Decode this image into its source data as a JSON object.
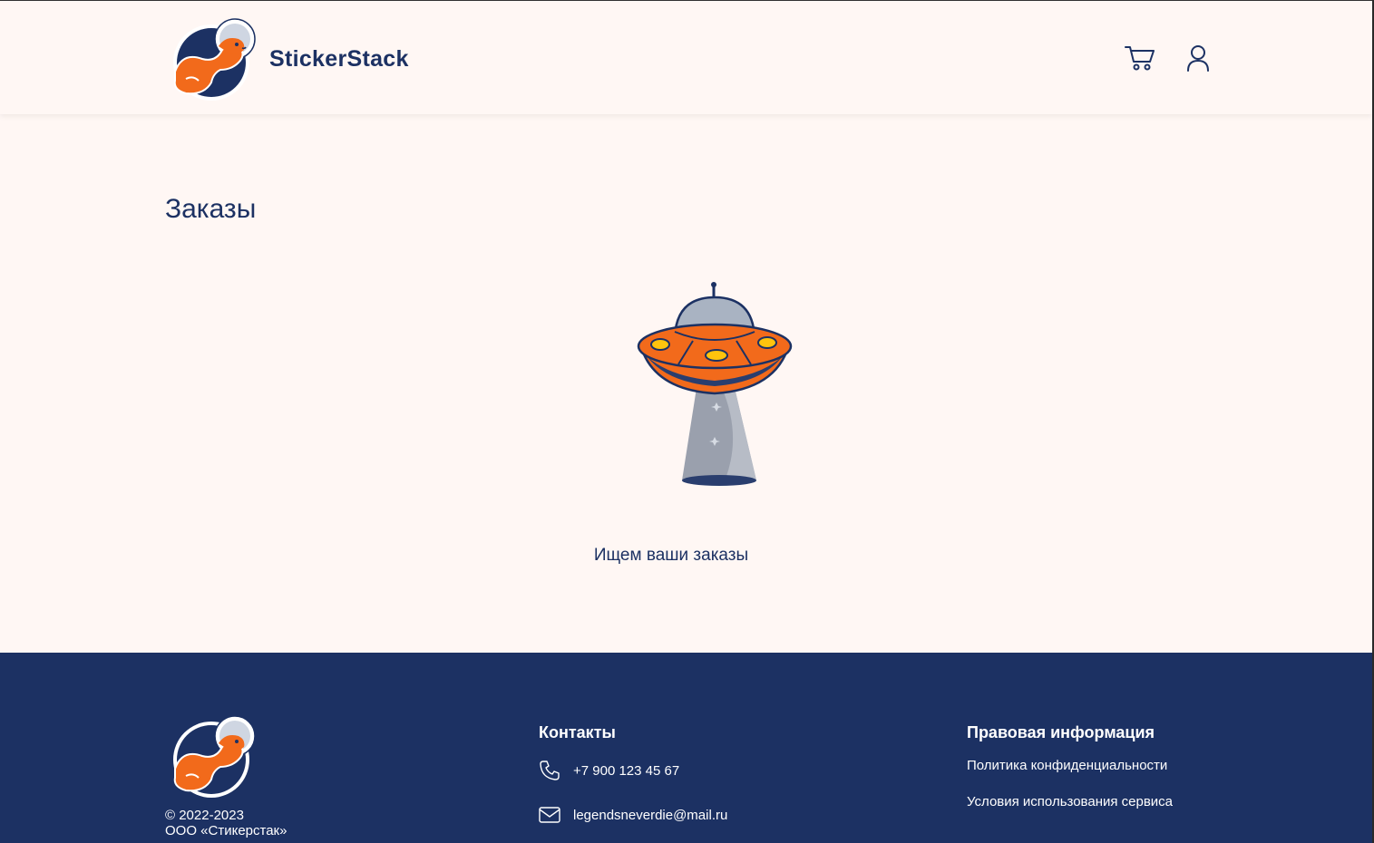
{
  "header": {
    "brand": "StickerStack",
    "cart_icon": "cart-icon",
    "user_icon": "user-icon"
  },
  "main": {
    "title": "Заказы",
    "empty_message": "Ищем ваши заказы",
    "illustration": "ufo-illustration"
  },
  "footer": {
    "copyright_years": "© 2022-2023",
    "company": "ООО «Стикерстак»",
    "contacts": {
      "title": "Контакты",
      "phone": "+7 900 123 45 67",
      "email": "legendsneverdie@mail.ru"
    },
    "legal": {
      "title": "Правовая информация",
      "links": [
        "Политика конфиденциальности",
        "Условия использования сервиса"
      ]
    }
  },
  "colors": {
    "background": "#fff7f4",
    "primary": "#1c3163",
    "accent": "#f26a1b"
  }
}
